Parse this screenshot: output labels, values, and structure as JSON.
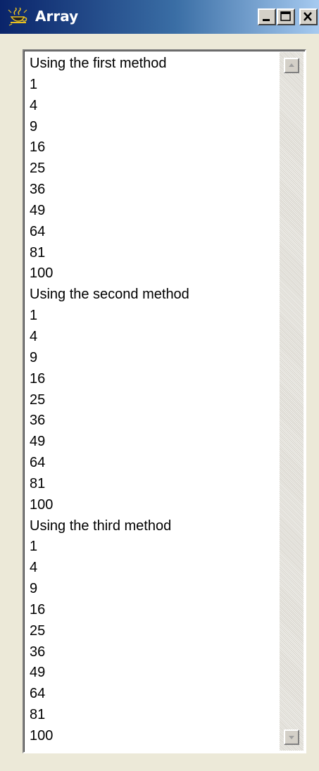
{
  "window": {
    "title": "Array",
    "app_icon": "java-cup-icon",
    "caption_buttons": [
      "minimize-icon",
      "maximize-icon",
      "close-icon"
    ]
  },
  "list": {
    "items": [
      " Using the first method",
      "1",
      "4",
      "9",
      "16",
      "25",
      "36",
      "49",
      "64",
      "81",
      "100",
      " Using the second method",
      "1",
      "4",
      "9",
      "16",
      "25",
      "36",
      "49",
      "64",
      "81",
      "100",
      " Using the third method",
      "1",
      "4",
      "9",
      "16",
      "25",
      "36",
      "49",
      "64",
      "81",
      "100"
    ]
  },
  "colors": {
    "titlebar_start": "#0a246a",
    "titlebar_end": "#a6caf0",
    "window_bg": "#ece9d8",
    "list_bg": "#ffffff"
  }
}
